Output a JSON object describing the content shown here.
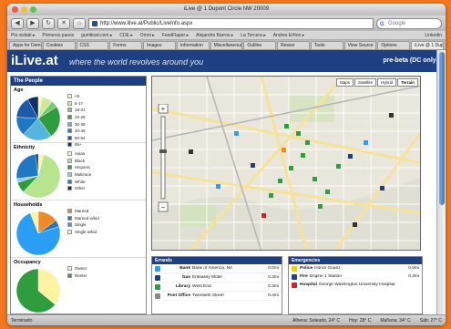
{
  "window": {
    "title": "iLive @ 1 Dupont Circle NW 20009"
  },
  "toolbar": {
    "url": "http://www.ilive.at/Public/LiveInfo.aspx",
    "search_placeholder": "Google"
  },
  "bookmarks": [
    "Più visitati ▸",
    "Primeros pasos",
    "gumltrad.com ▸",
    "CDE ▸",
    "Omni ▸",
    "FeedFlaper ▸",
    "Alejandro Barros ▸",
    "La Tercera ▸",
    "Andres Erfton ▸"
  ],
  "bookmarks_right": "Linkedin",
  "tabs": [
    "Apps for Democrac...",
    "Cookies",
    "CSS",
    "Forms",
    "Images",
    "Information",
    "Miscellaneous",
    "Outline",
    "Resize",
    "Tools",
    "View Source",
    "Options",
    "iLive @ 1 Dupont Ci..."
  ],
  "header": {
    "logo": "iLive.at",
    "tagline": "where the world revolves around you",
    "badge": "pre-beta (DC only)"
  },
  "people": {
    "title": "The People",
    "sections": [
      {
        "title": "Age",
        "legend": [
          "<5",
          "5-17",
          "18-21",
          "22-29",
          "30-39",
          "40-49",
          "50-64",
          "65+"
        ],
        "colors": [
          "#fff3a3",
          "#cfe89a",
          "#6fcf6f",
          "#2e9d3e",
          "#54b6df",
          "#1f78c4",
          "#1c5aa8",
          "#0d2f6e"
        ],
        "values": [
          0.03,
          0.08,
          0.05,
          0.24,
          0.22,
          0.14,
          0.16,
          0.08
        ]
      },
      {
        "title": "Ethnicity",
        "legend": [
          "Asian",
          "Black",
          "Hispanic",
          "Multirace",
          "White",
          "Other"
        ],
        "colors": [
          "#fff3a3",
          "#b7e58f",
          "#2e9d3e",
          "#8fd0ef",
          "#1f78c4",
          "#0d2f6e"
        ],
        "values": [
          0.04,
          0.58,
          0.08,
          0.03,
          0.25,
          0.02
        ]
      },
      {
        "title": "Households",
        "legend": [
          "Married",
          "Married w/kid",
          "Single",
          "Single w/kid"
        ],
        "colors": [
          "#f08a24",
          "#1f78c4",
          "#2a9df4",
          "#fff3a3"
        ],
        "values": [
          0.15,
          0.05,
          0.74,
          0.06
        ]
      },
      {
        "title": "Occupancy",
        "legend": [
          "Owner",
          "Renter"
        ],
        "colors": [
          "#fff3a3",
          "#2e9d3e"
        ],
        "values": [
          0.36,
          0.64
        ]
      }
    ]
  },
  "map": {
    "buttons": [
      "Maps",
      "Satellite",
      "Hybrid",
      "Terrain"
    ],
    "active_button": "Terrain"
  },
  "errands": {
    "title": "Errands",
    "rows": [
      {
        "label": "Bank",
        "place": "Bank of America, NA",
        "dist": "0.0mi",
        "color": "#2a9df4"
      },
      {
        "label": "Gas",
        "place": "Embassy Mobil",
        "dist": "0.3mi",
        "color": "#1e4082"
      },
      {
        "label": "Library",
        "place": "West End",
        "dist": "0.3mi",
        "color": "#2e9d3e"
      },
      {
        "label": "Post Office",
        "place": "Twentieth Street",
        "dist": "0.4mi",
        "color": "#888888"
      }
    ]
  },
  "emergencies": {
    "title": "Emergencies",
    "rows": [
      {
        "label": "Police",
        "place": "Honor Guard",
        "dist": "0.0mi",
        "color": "#f0d400"
      },
      {
        "label": "Fire",
        "place": "Engine 1 Station",
        "dist": "0.3mi",
        "color": "#1e4082"
      },
      {
        "label": "Hospital",
        "place": "George Washington University Hospital",
        "dist": "",
        "color": "#d62020"
      }
    ]
  },
  "status": {
    "left": "Terminado",
    "right": [
      "Alhena: Soleado, 24° C",
      "Hoy: 28° C",
      "Mañana: 34° C",
      "Sáb: 27° C"
    ]
  }
}
